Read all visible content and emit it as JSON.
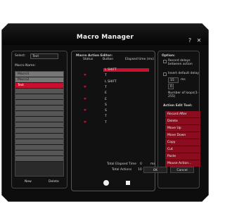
{
  "title": "Macro Manager",
  "window": {
    "help_label": "?",
    "close_label": "✕"
  },
  "left": {
    "select_label": "Select:",
    "select_value": "Text",
    "macro_name_label": "Macro Name:",
    "macros": [
      "Macro1",
      "Macro2",
      "Test"
    ],
    "new_label": "New",
    "delete_label": "Delete"
  },
  "middle": {
    "title": "Macro Action Editor:",
    "headers": {
      "status": "Status",
      "button": "Button",
      "elapsed": "Elapsed time (ms)"
    },
    "rows": [
      {
        "button": "L SHIFT",
        "icon": "",
        "selected": true
      },
      {
        "button": "T",
        "icon": "heart"
      },
      {
        "button": "L SHIFT",
        "icon": ""
      },
      {
        "button": "T",
        "icon": "heart"
      },
      {
        "button": "E",
        "icon": ""
      },
      {
        "button": "E",
        "icon": "heart"
      },
      {
        "button": "S",
        "icon": ""
      },
      {
        "button": "S",
        "icon": "heart"
      },
      {
        "button": "T",
        "icon": ""
      },
      {
        "button": "T",
        "icon": "heart"
      }
    ],
    "total_elapsed_label": "Total Elapsed Time",
    "total_elapsed_value": "0",
    "total_elapsed_unit": "ms",
    "total_actions_label": "Total Actions",
    "total_actions_value": "10",
    "total_actions_unit": "Entries"
  },
  "right": {
    "title": "Option:",
    "record_delays_label": "Record delays between action",
    "insert_delay_label": "Insert default delay",
    "delay_value": "15",
    "delay_unit": "ms",
    "loops_label": "Number of loops(1-255)",
    "loops_value": "0",
    "tools_title": "Action Edit Tool:",
    "tools": [
      "Record After",
      "Delete",
      "Move Up",
      "Move Down",
      "Copy",
      "Cut",
      "Paste",
      "Mouse Action..."
    ]
  },
  "footer": {
    "ok_label": "OK",
    "cancel_label": "Cancel"
  }
}
